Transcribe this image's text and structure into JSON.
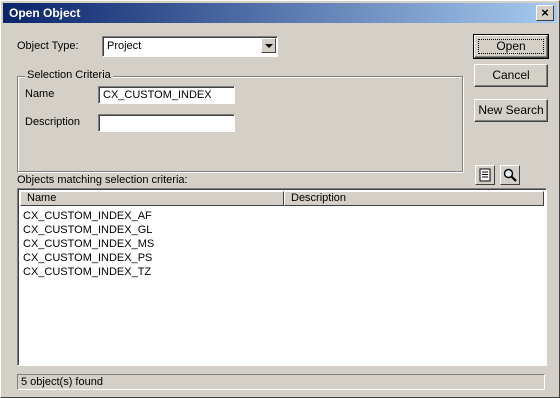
{
  "window": {
    "title": "Open Object",
    "close_glyph": "×"
  },
  "object_type": {
    "label": "Object Type:",
    "selected": "Project"
  },
  "selection_criteria": {
    "legend": "Selection Criteria",
    "name_label": "Name",
    "name_value": "CX_CUSTOM_INDEX",
    "description_label": "Description",
    "description_value": ""
  },
  "buttons": {
    "open": "Open",
    "cancel": "Cancel",
    "new_search": "New Search"
  },
  "results": {
    "label": "Objects matching selection criteria:",
    "columns": [
      "Name",
      "Description"
    ],
    "rows": [
      {
        "name": "CX_CUSTOM_INDEX_AF",
        "description": ""
      },
      {
        "name": "CX_CUSTOM_INDEX_GL",
        "description": ""
      },
      {
        "name": "CX_CUSTOM_INDEX_MS",
        "description": ""
      },
      {
        "name": "CX_CUSTOM_INDEX_PS",
        "description": ""
      },
      {
        "name": "CX_CUSTOM_INDEX_TZ",
        "description": ""
      }
    ]
  },
  "icons": {
    "properties": "list-properties-icon",
    "search": "magnifier-icon"
  },
  "status": {
    "text": "5 object(s) found"
  }
}
